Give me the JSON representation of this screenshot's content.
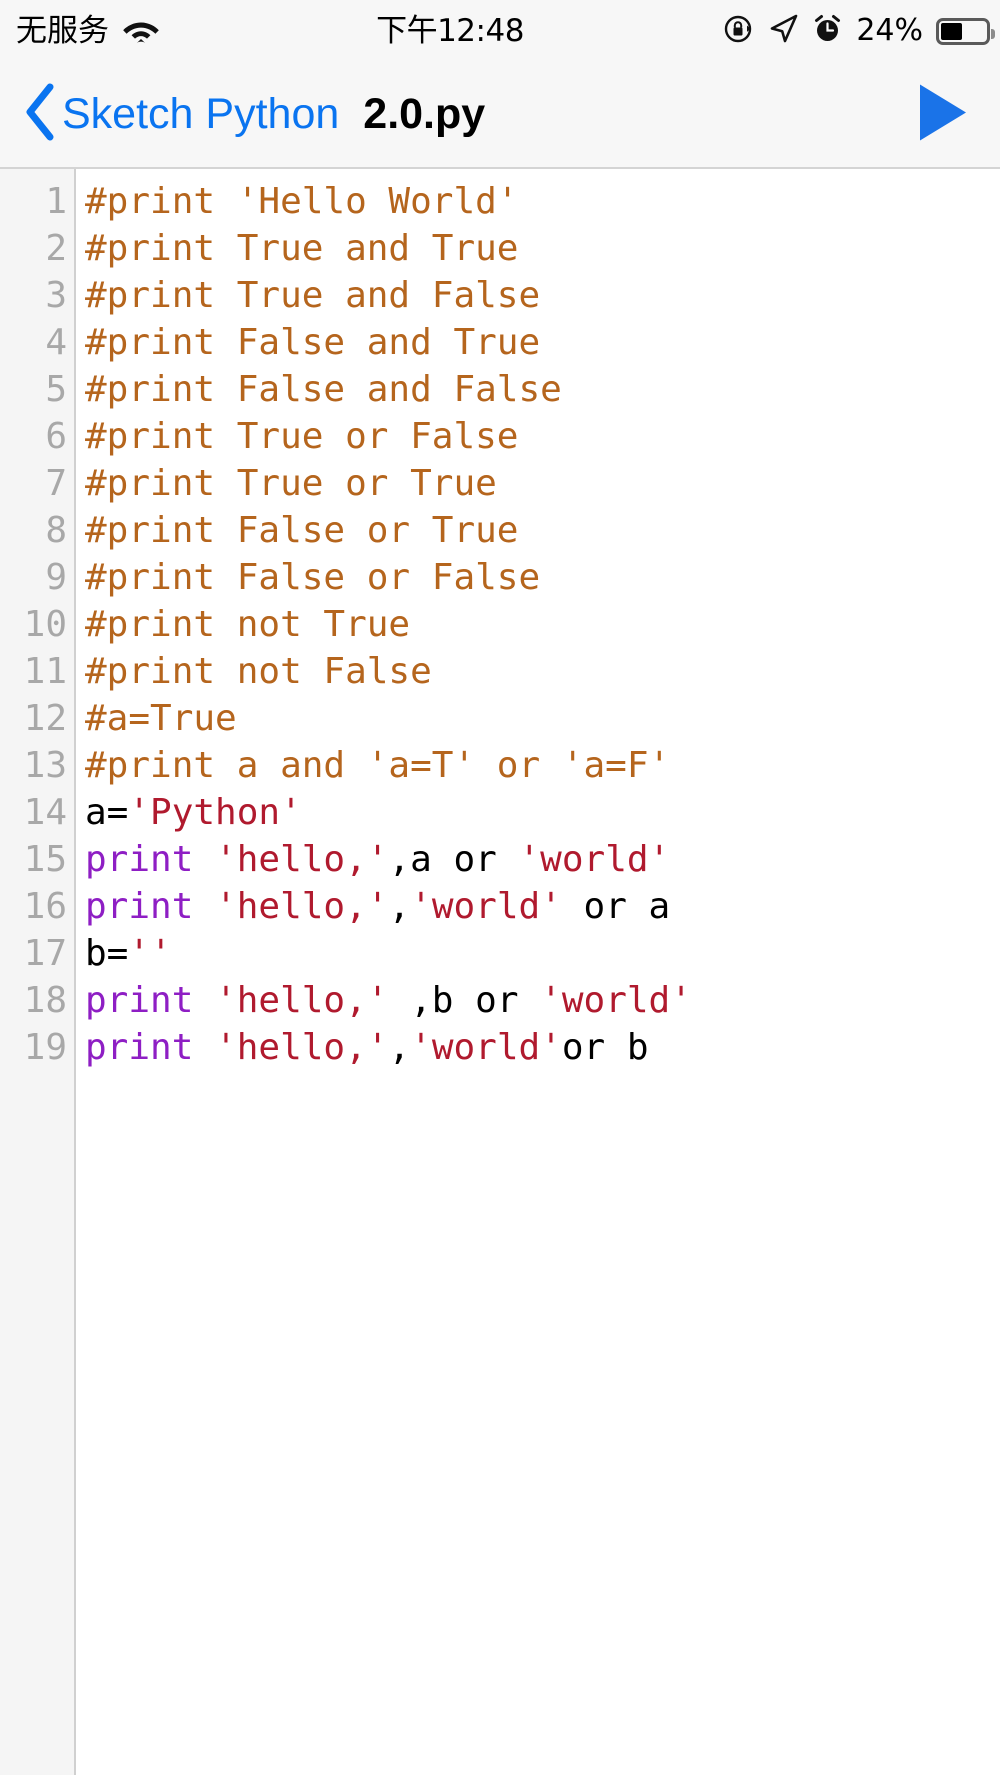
{
  "status_bar": {
    "carrier": "无服务",
    "wifi_icon": "wifi-icon",
    "time": "下午12:48",
    "rotation_lock_icon": "rotation-lock-icon",
    "location_icon": "location-arrow-icon",
    "alarm_icon": "alarm-clock-icon",
    "battery_percent": "24%",
    "battery_level": 24
  },
  "nav_bar": {
    "back_icon": "chevron-left-icon",
    "back_label": "Sketch Python",
    "title": "2.0.py",
    "run_icon": "play-triangle-icon"
  },
  "colors": {
    "accent_blue": "#0a74f0",
    "comment": "#b5651d",
    "keyword": "#8e1ec4",
    "string": "#b01a2e",
    "plain": "#000000",
    "gutter_bg": "#f5f5f5",
    "gutter_text": "#a8a8a8",
    "editor_bg": "#ffffff",
    "chrome_bg": "#f7f7f7"
  },
  "editor": {
    "language": "python",
    "line_numbers": [
      "1",
      "2",
      "3",
      "4",
      "5",
      "6",
      "7",
      "8",
      "9",
      "10",
      "11",
      "12",
      "13",
      "14",
      "15",
      "16",
      "17",
      "18",
      "19"
    ],
    "lines": [
      {
        "n": "1",
        "tokens": [
          {
            "t": "#print 'Hello World'",
            "c": "comment"
          }
        ]
      },
      {
        "n": "2",
        "tokens": [
          {
            "t": "#print True and True",
            "c": "comment"
          }
        ]
      },
      {
        "n": "3",
        "tokens": [
          {
            "t": "#print True and False",
            "c": "comment"
          }
        ]
      },
      {
        "n": "4",
        "tokens": [
          {
            "t": "#print False and True",
            "c": "comment"
          }
        ]
      },
      {
        "n": "5",
        "tokens": [
          {
            "t": "#print False and False",
            "c": "comment"
          }
        ]
      },
      {
        "n": "6",
        "tokens": [
          {
            "t": "#print True or False",
            "c": "comment"
          }
        ]
      },
      {
        "n": "7",
        "tokens": [
          {
            "t": "#print True or True",
            "c": "comment"
          }
        ]
      },
      {
        "n": "8",
        "tokens": [
          {
            "t": "#print False or True",
            "c": "comment"
          }
        ]
      },
      {
        "n": "9",
        "tokens": [
          {
            "t": "#print False or False",
            "c": "comment"
          }
        ]
      },
      {
        "n": "10",
        "tokens": [
          {
            "t": "#print not True",
            "c": "comment"
          }
        ]
      },
      {
        "n": "11",
        "tokens": [
          {
            "t": "#print not False",
            "c": "comment"
          }
        ]
      },
      {
        "n": "12",
        "tokens": [
          {
            "t": "#a=True",
            "c": "comment"
          }
        ]
      },
      {
        "n": "13",
        "tokens": [
          {
            "t": "#print a and 'a=T' or 'a=F'",
            "c": "comment"
          }
        ]
      },
      {
        "n": "14",
        "tokens": [
          {
            "t": "a=",
            "c": "plain"
          },
          {
            "t": "'Python'",
            "c": "string"
          }
        ]
      },
      {
        "n": "15",
        "tokens": [
          {
            "t": "print",
            "c": "keyword"
          },
          {
            "t": " ",
            "c": "plain"
          },
          {
            "t": "'hello,'",
            "c": "string"
          },
          {
            "t": ",a or ",
            "c": "plain"
          },
          {
            "t": "'world'",
            "c": "string"
          }
        ]
      },
      {
        "n": "16",
        "tokens": [
          {
            "t": "print",
            "c": "keyword"
          },
          {
            "t": " ",
            "c": "plain"
          },
          {
            "t": "'hello,'",
            "c": "string"
          },
          {
            "t": ",",
            "c": "plain"
          },
          {
            "t": "'world'",
            "c": "string"
          },
          {
            "t": " or a",
            "c": "plain"
          }
        ]
      },
      {
        "n": "17",
        "tokens": [
          {
            "t": "b=",
            "c": "plain"
          },
          {
            "t": "''",
            "c": "string"
          }
        ]
      },
      {
        "n": "18",
        "tokens": [
          {
            "t": "print",
            "c": "keyword"
          },
          {
            "t": " ",
            "c": "plain"
          },
          {
            "t": "'hello,'",
            "c": "string"
          },
          {
            "t": " ,b or ",
            "c": "plain"
          },
          {
            "t": "'world'",
            "c": "string"
          }
        ]
      },
      {
        "n": "19",
        "tokens": [
          {
            "t": "print",
            "c": "keyword"
          },
          {
            "t": " ",
            "c": "plain"
          },
          {
            "t": "'hello,'",
            "c": "string"
          },
          {
            "t": ",",
            "c": "plain"
          },
          {
            "t": "'world'",
            "c": "string"
          },
          {
            "t": "or b",
            "c": "plain"
          }
        ]
      }
    ]
  }
}
